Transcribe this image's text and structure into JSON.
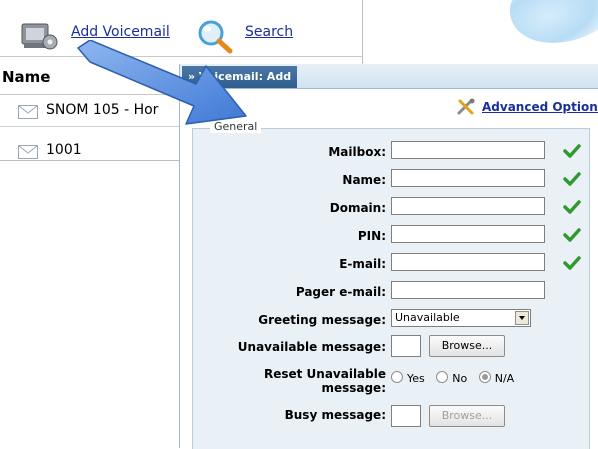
{
  "toolbar": {
    "add_voicemail": "Add Voicemail",
    "search": "Search"
  },
  "list": {
    "column_header": "Name",
    "rows": [
      {
        "label": "SNOM 105 - Hor"
      },
      {
        "label": "1001"
      }
    ]
  },
  "dialog": {
    "title": "» Voicemail: Add",
    "advanced_options": "Advanced Options",
    "legend": "General",
    "fields": {
      "mailbox": {
        "label": "Mailbox:",
        "value": ""
      },
      "name": {
        "label": "Name:",
        "value": ""
      },
      "domain": {
        "label": "Domain:",
        "value": ""
      },
      "pin": {
        "label": "PIN:",
        "value": ""
      },
      "email": {
        "label": "E-mail:",
        "value": ""
      },
      "pager_email": {
        "label": "Pager e-mail:",
        "value": ""
      },
      "greeting_message": {
        "label": "Greeting message:",
        "selected": "Unavailable"
      },
      "unavailable_message": {
        "label": "Unavailable message:",
        "browse": "Browse..."
      },
      "reset_unavailable": {
        "label_line1": "Reset Unavailable",
        "label_line2": "message:",
        "options": [
          "Yes",
          "No",
          "N/A"
        ],
        "selected": "N/A"
      },
      "busy_message": {
        "label": "Busy message:",
        "browse": "Browse..."
      }
    }
  },
  "colors": {
    "link": "#1a2f9a",
    "check_green": "#2e9a2e",
    "arrow_blue": "#5b8fe0",
    "title_blue": "#2f5e8f",
    "fieldset_bg": "#e9f1f7"
  },
  "icons": [
    "add-voicemail-icon",
    "search-icon",
    "envelope-icon",
    "advanced-options-icon",
    "checkmark-icon",
    "dropdown-arrow-icon"
  ]
}
